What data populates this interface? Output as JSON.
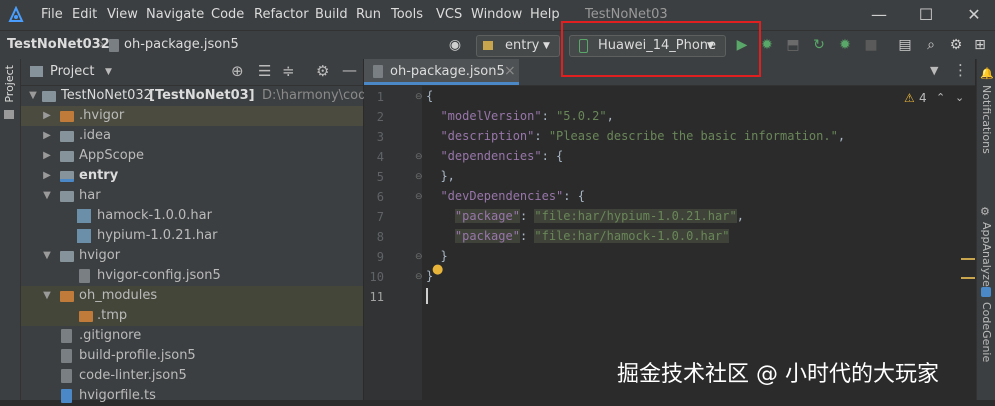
{
  "titlebar": {
    "menu": [
      "File",
      "Edit",
      "View",
      "Navigate",
      "Code",
      "Refactor",
      "Build",
      "Run",
      "Tools",
      "VCS",
      "Window",
      "Help"
    ],
    "project_title": "TestNoNet03",
    "minimize": "—",
    "maximize": "☐",
    "close": "✕"
  },
  "navbar": {
    "project": "TestNoNet032",
    "file": "oh-package.json5",
    "module": "entry",
    "device": "Huawei_14_Phone"
  },
  "project_panel": {
    "title": "Project",
    "tree": [
      {
        "label": "TestNoNet032",
        "bold_suffix": "[TestNoNet03]",
        "path": "D:\\harmony\\code\\te"
      },
      {
        "label": ".hvigor"
      },
      {
        "label": ".idea"
      },
      {
        "label": "AppScope"
      },
      {
        "label": "entry"
      },
      {
        "label": "har"
      },
      {
        "label": "hamock-1.0.0.har"
      },
      {
        "label": "hypium-1.0.21.har"
      },
      {
        "label": "hvigor"
      },
      {
        "label": "hvigor-config.json5"
      },
      {
        "label": "oh_modules"
      },
      {
        "label": ".tmp"
      },
      {
        "label": ".gitignore"
      },
      {
        "label": "build-profile.json5"
      },
      {
        "label": "code-linter.json5"
      },
      {
        "label": "hvigorfile.ts"
      }
    ]
  },
  "editor": {
    "tab_label": "oh-package.json5",
    "tab_close": "×",
    "warnings": "4",
    "line_numbers": [
      "1",
      "2",
      "3",
      "4",
      "5",
      "6",
      "7",
      "8",
      "9",
      "10",
      "11"
    ],
    "lines": {
      "l1": "{",
      "l2_key": "\"modelVersion\"",
      "l2_val": "\"5.0.2\"",
      "l3_key": "\"description\"",
      "l3_val": "\"Please describe the basic information.\"",
      "l4_key": "\"dependencies\"",
      "l4_rest": ": {",
      "l5": "},",
      "l6_key": "\"devDependencies\"",
      "l6_rest": ": {",
      "l7_key": "\"package\"",
      "l7_val": "\"file:har/hypium-1.0.21.har\"",
      "l8_key": "\"package\"",
      "l8_val": "\"file:har/hamock-1.0.0.har\"",
      "l9": "}",
      "l10": "}"
    }
  },
  "right_strip": [
    "Notifications",
    "AppAnalyzer",
    "CodeGenie"
  ],
  "left_strip": [
    "Project"
  ],
  "watermark": "掘金技术社区 @ 小时代的大玩家",
  "colors": {
    "bg": "#2b2b2b",
    "panel": "#3c3f41",
    "highlight": "#e02020",
    "run_green": "#59a869",
    "folder_orange": "#c07a3a",
    "folder_blue": "#87939a"
  }
}
